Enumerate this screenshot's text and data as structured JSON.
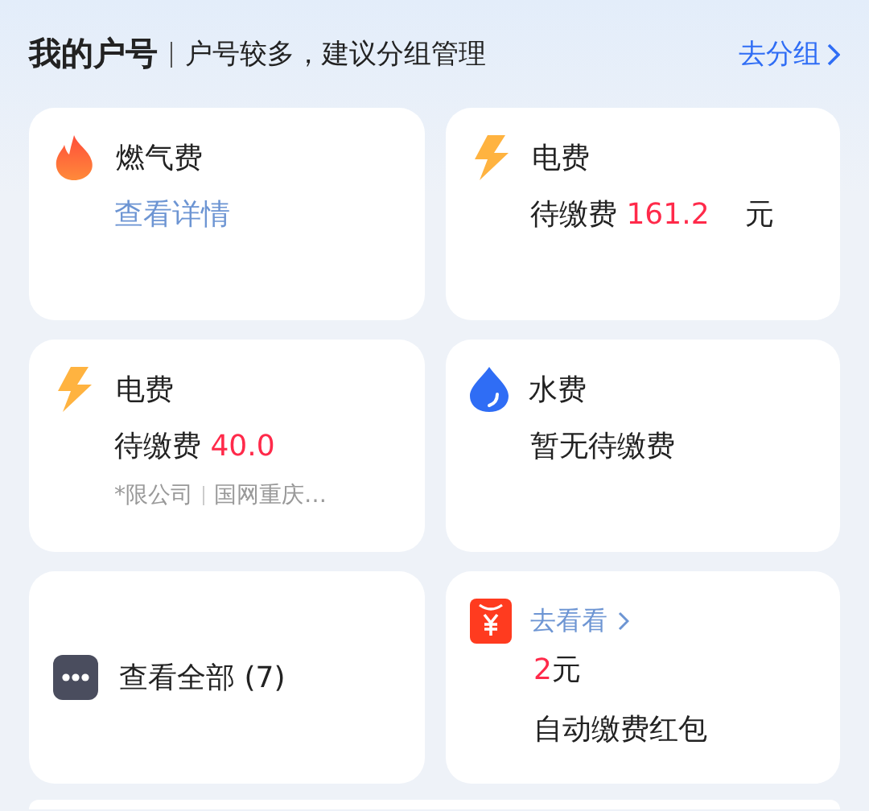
{
  "header": {
    "title": "我的户号",
    "hint": "户号较多，建议分组管理",
    "action": "去分组"
  },
  "accounts": [
    {
      "kind": "gas",
      "name": "燃气费",
      "status": {
        "kind": "link",
        "text": "查看详情"
      }
    },
    {
      "kind": "electric",
      "name": "电费",
      "status": {
        "kind": "due",
        "label": "待缴费",
        "amount": "161.2",
        "unit": "元"
      }
    },
    {
      "kind": "electric",
      "name": "电费",
      "status": {
        "kind": "due",
        "label": "待缴费",
        "amount": "40.0"
      },
      "note": [
        "*限公司",
        "国网重庆…"
      ]
    },
    {
      "kind": "water",
      "name": "水费",
      "status": {
        "kind": "plain",
        "text": "暂无待缴费"
      }
    }
  ],
  "view_all": {
    "label": "查看全部 (7)"
  },
  "promo": {
    "link": "去看看",
    "amount": "2",
    "unit": "元",
    "caption": "自动缴费红包"
  }
}
